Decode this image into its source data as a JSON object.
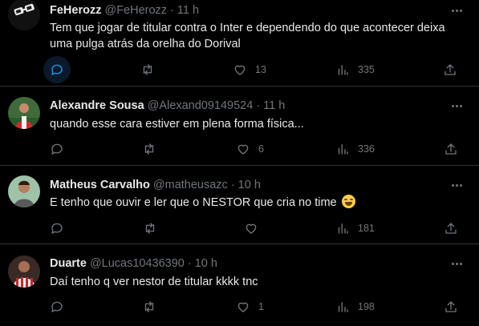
{
  "tweets": [
    {
      "name": "FeHerozz",
      "handle": "@FeHerozz",
      "time": "11 h",
      "text": "Tem que jogar de titular contra o Inter e dependendo do que acontecer deixa uma pulga atrás da orelha do Dorival",
      "emoji": "",
      "replies": "",
      "retweets": "",
      "likes": "13",
      "views": "335",
      "reply_highlighted": true
    },
    {
      "name": "Alexandre Sousa",
      "handle": "@Alexand09149524",
      "time": "11 h",
      "text": "quando esse cara estiver em plena forma física...",
      "emoji": "",
      "replies": "",
      "retweets": "",
      "likes": "6",
      "views": "336",
      "reply_highlighted": false
    },
    {
      "name": "Matheus Carvalho",
      "handle": "@matheusazc",
      "time": "10 h",
      "text": "E tenho que ouvir e ler que o NESTOR que cria no time",
      "emoji": "joy-emoji",
      "replies": "",
      "retweets": "",
      "likes": "",
      "views": "181",
      "reply_highlighted": false
    },
    {
      "name": "Duarte",
      "handle": "@Lucas10436390",
      "time": "10 h",
      "text": "Daí tenho q ver nestor de titular kkkk tnc",
      "emoji": "",
      "replies": "",
      "retweets": "",
      "likes": "1",
      "views": "198",
      "reply_highlighted": false
    }
  ],
  "separator": "·",
  "icons": {
    "reply": "reply-bubble-icon",
    "retweet": "retweet-arrows-icon",
    "like": "heart-icon",
    "views": "bar-chart-icon",
    "share": "share-upload-icon",
    "more": "more-dots-icon"
  },
  "colors": {
    "background": "#000000",
    "text": "#e7e9ea",
    "muted": "#71767b",
    "accent": "#1d9bf0",
    "border": "#2f3336"
  }
}
